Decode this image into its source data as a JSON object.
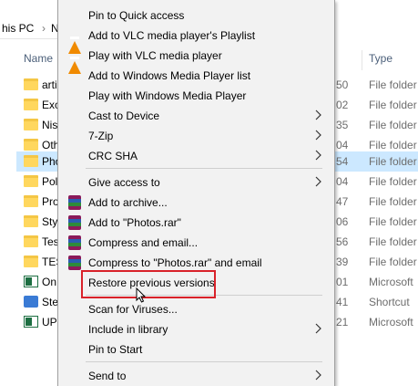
{
  "breadcrumb": {
    "part1": "his PC",
    "part2": "N"
  },
  "columns": {
    "name": "Name",
    "type": "Type"
  },
  "files": [
    {
      "name": "arti",
      "date": "50",
      "type": "File folder",
      "icon": "folder-icon",
      "selected": false
    },
    {
      "name": "Exc",
      "date": "02",
      "type": "File folder",
      "icon": "folder-icon",
      "selected": false
    },
    {
      "name": "Nis",
      "date": "35",
      "type": "File folder",
      "icon": "folder-icon",
      "selected": false
    },
    {
      "name": "Oth",
      "date": "04",
      "type": "File folder",
      "icon": "folder-icon",
      "selected": false
    },
    {
      "name": "Pho",
      "date": "54",
      "type": "File folder",
      "icon": "folder-icon",
      "selected": true
    },
    {
      "name": "Pol",
      "date": "04",
      "type": "File folder",
      "icon": "folder-icon",
      "selected": false
    },
    {
      "name": "Pro",
      "date": "47",
      "type": "File folder",
      "icon": "folder-icon",
      "selected": false
    },
    {
      "name": "Sty",
      "date": "06",
      "type": "File folder",
      "icon": "folder-icon",
      "selected": false
    },
    {
      "name": "Tes",
      "date": "56",
      "type": "File folder",
      "icon": "folder-icon",
      "selected": false
    },
    {
      "name": "TES",
      "date": "39",
      "type": "File folder",
      "icon": "folder-icon",
      "selected": false
    },
    {
      "name": "On",
      "date": "01",
      "type": "Microsoft",
      "icon": "excel-icon",
      "selected": false
    },
    {
      "name": "Ste",
      "date": "41",
      "type": "Shortcut",
      "icon": "shortcut-icon",
      "selected": false
    },
    {
      "name": "UPI",
      "date": "21",
      "type": "Microsoft",
      "icon": "excel-icon",
      "selected": false
    }
  ],
  "menu": {
    "items": [
      {
        "label": "Pin to Quick access",
        "icon": "",
        "submenu": false
      },
      {
        "label": "Add to VLC media player's Playlist",
        "icon": "vlc-icon",
        "submenu": false
      },
      {
        "label": "Play with VLC media player",
        "icon": "vlc-icon",
        "submenu": false
      },
      {
        "label": "Add to Windows Media Player list",
        "icon": "",
        "submenu": false
      },
      {
        "label": "Play with Windows Media Player",
        "icon": "",
        "submenu": false
      },
      {
        "label": "Cast to Device",
        "icon": "",
        "submenu": true
      },
      {
        "label": "7-Zip",
        "icon": "",
        "submenu": true
      },
      {
        "label": "CRC SHA",
        "icon": "",
        "submenu": true
      },
      {
        "label": "Give access to",
        "icon": "",
        "submenu": true
      },
      {
        "label": "Add to archive...",
        "icon": "winrar-icon",
        "submenu": false
      },
      {
        "label": "Add to \"Photos.rar\"",
        "icon": "winrar-icon",
        "submenu": false
      },
      {
        "label": "Compress and email...",
        "icon": "winrar-icon",
        "submenu": false
      },
      {
        "label": "Compress to \"Photos.rar\" and email",
        "icon": "winrar-icon",
        "submenu": false
      },
      {
        "label": "Restore previous versions",
        "icon": "",
        "submenu": false
      },
      {
        "label": "Scan for Viruses...",
        "icon": "",
        "submenu": false
      },
      {
        "label": "Include in library",
        "icon": "",
        "submenu": true
      },
      {
        "label": "Pin to Start",
        "icon": "",
        "submenu": false
      },
      {
        "label": "Send to",
        "icon": "",
        "submenu": true
      }
    ]
  },
  "colors": {
    "selection": "#cce8ff",
    "highlight_box": "#d9222a",
    "menu_bg": "#f2f2f2"
  }
}
